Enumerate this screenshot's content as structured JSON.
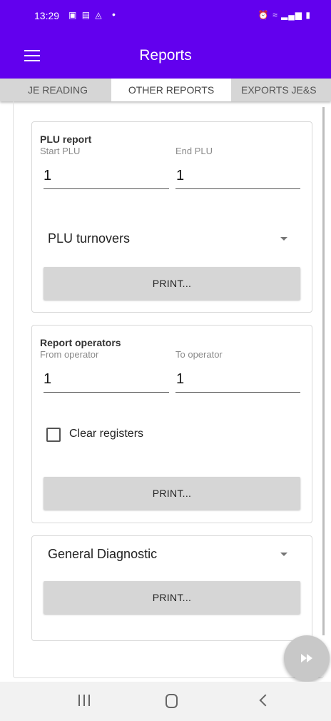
{
  "status_bar": {
    "time": "13:29",
    "left_icons": [
      "gallery-icon",
      "contact-card-icon",
      "drive-icon"
    ],
    "dot": "•",
    "right_icons": [
      "alarm-icon",
      "wifi-icon",
      "signal-icon",
      "signal-icon",
      "battery-icon"
    ]
  },
  "app_bar": {
    "title": "Reports",
    "color": "#6200EE"
  },
  "tabs": [
    {
      "label": "JE READING",
      "selected": false
    },
    {
      "label": "OTHER REPORTS",
      "selected": true
    },
    {
      "label": "EXPORTS JE&S",
      "selected": false
    }
  ],
  "plu_report": {
    "title": "PLU report",
    "start_label": "Start PLU",
    "start_value": "1",
    "end_label": "End PLU",
    "end_value": "1",
    "select_value": "PLU turnovers",
    "print_label": "PRINT..."
  },
  "report_operators": {
    "title": "Report operators",
    "from_label": "From operator",
    "from_value": "1",
    "to_label": "To operator",
    "to_value": "1",
    "checkbox_label": "Clear registers",
    "checkbox_checked": false,
    "print_label": "PRINT..."
  },
  "diagnostic": {
    "select_value": "General Diagnostic",
    "print_label": "PRINT..."
  },
  "fab": {
    "icon": "fast-forward-icon"
  },
  "nav_bar": {
    "icons": [
      "recent-apps-icon",
      "home-icon",
      "back-icon"
    ]
  }
}
